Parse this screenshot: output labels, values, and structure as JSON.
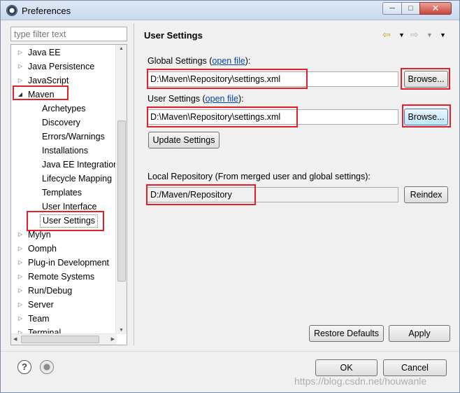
{
  "window": {
    "title": "Preferences"
  },
  "filter": {
    "placeholder": "type filter text"
  },
  "tree": {
    "items": [
      {
        "label": "Java EE",
        "level": 0,
        "state": "collapsed"
      },
      {
        "label": "Java Persistence",
        "level": 0,
        "state": "collapsed"
      },
      {
        "label": "JavaScript",
        "level": 0,
        "state": "collapsed"
      },
      {
        "label": "Maven",
        "level": 0,
        "state": "expanded"
      },
      {
        "label": "Archetypes",
        "level": 1,
        "state": "leaf"
      },
      {
        "label": "Discovery",
        "level": 1,
        "state": "leaf"
      },
      {
        "label": "Errors/Warnings",
        "level": 1,
        "state": "leaf"
      },
      {
        "label": "Installations",
        "level": 1,
        "state": "leaf"
      },
      {
        "label": "Java EE Integration",
        "level": 1,
        "state": "leaf"
      },
      {
        "label": "Lifecycle Mapping",
        "level": 1,
        "state": "leaf"
      },
      {
        "label": "Templates",
        "level": 1,
        "state": "leaf"
      },
      {
        "label": "User Interface",
        "level": 1,
        "state": "leaf"
      },
      {
        "label": "User Settings",
        "level": 1,
        "state": "selected"
      },
      {
        "label": "Mylyn",
        "level": 0,
        "state": "collapsed"
      },
      {
        "label": "Oomph",
        "level": 0,
        "state": "collapsed"
      },
      {
        "label": "Plug-in Development",
        "level": 0,
        "state": "collapsed"
      },
      {
        "label": "Remote Systems",
        "level": 0,
        "state": "collapsed"
      },
      {
        "label": "Run/Debug",
        "level": 0,
        "state": "collapsed"
      },
      {
        "label": "Server",
        "level": 0,
        "state": "collapsed"
      },
      {
        "label": "Team",
        "level": 0,
        "state": "collapsed"
      },
      {
        "label": "Terminal",
        "level": 0,
        "state": "collapsed"
      }
    ]
  },
  "page": {
    "title": "User Settings",
    "global_label": "Global Settings (",
    "global_link": "open file",
    "global_suffix": "):",
    "global_path": "D:\\Maven\\Repository\\settings.xml",
    "user_label": "User Settings (",
    "user_link": "open file",
    "user_suffix": "):",
    "user_path": "D:\\Maven\\Repository\\settings.xml",
    "browse_label": "Browse...",
    "update_label": "Update Settings",
    "local_repo_label": "Local Repository (From merged user and global settings):",
    "local_repo_path": "D:/Maven/Repository",
    "reindex_label": "Reindex",
    "restore_label": "Restore Defaults",
    "apply_label": "Apply"
  },
  "footer": {
    "ok_label": "OK",
    "cancel_label": "Cancel",
    "watermark": "https://blog.csdn.net/houwanle"
  },
  "colors": {
    "highlight": "#e0202a",
    "link": "#0645ad",
    "selection_focus": "#3c7fb1"
  },
  "icons": [
    "back-arrow-icon",
    "forward-arrow-icon",
    "dropdown-icon",
    "view-menu-icon",
    "help-icon",
    "record-icon"
  ]
}
